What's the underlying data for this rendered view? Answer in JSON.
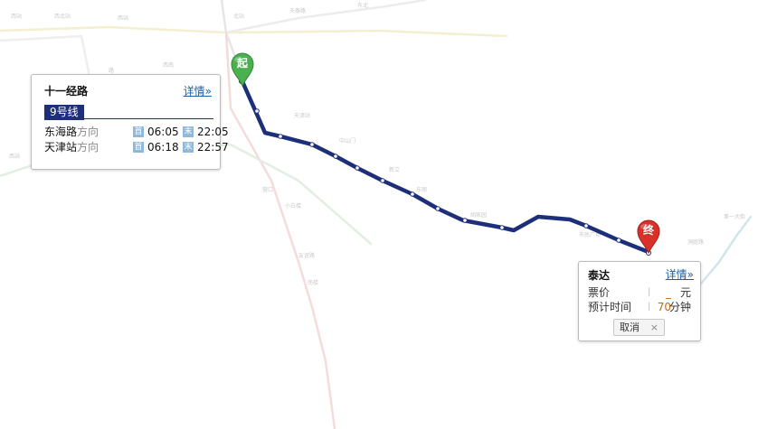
{
  "line_card": {
    "station": "十一经路",
    "detail_label": "详情»",
    "line_tab": "9号线",
    "directions": [
      {
        "terminal": "东海路",
        "suffix": "方向",
        "first_badge": "首",
        "first_time": "06:05",
        "last_badge": "末",
        "last_time": "22:05"
      },
      {
        "terminal": "天津站",
        "suffix": "方向",
        "first_badge": "首",
        "first_time": "06:18",
        "last_badge": "末",
        "last_time": "22:57"
      }
    ]
  },
  "stop_card": {
    "station": "泰达",
    "detail_label": "详情»",
    "fare": {
      "label": "票价",
      "separator": "|",
      "value": "_",
      "unit": "元"
    },
    "eta": {
      "label": "预计时间",
      "separator": "|",
      "value": "70",
      "unit": "分钟"
    },
    "cancel_label": "取消",
    "cancel_x": "×"
  },
  "markers": {
    "start": {
      "text": "起",
      "color": "#4caf50"
    },
    "end": {
      "text": "终",
      "color": "#d9312a"
    }
  },
  "route": {
    "color": "#1d2f7a"
  }
}
